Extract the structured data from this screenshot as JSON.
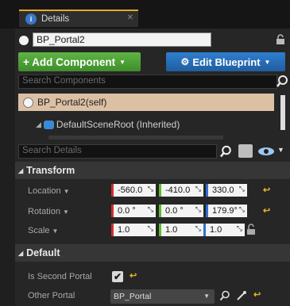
{
  "tab": {
    "title": "Details"
  },
  "actor": {
    "name": "BP_Portal2"
  },
  "toolbar": {
    "add_component": "+ Add Component",
    "edit_blueprint": "Edit Blueprint"
  },
  "components": {
    "search_placeholder": "Search Components",
    "root_item": "BP_Portal2(self)",
    "child_item": "DefaultSceneRoot (Inherited)"
  },
  "details": {
    "search_placeholder": "Search Details"
  },
  "transform": {
    "title": "Transform",
    "location": {
      "label": "Location",
      "x": "-560.0",
      "y": "-410.0",
      "z": "330.0"
    },
    "rotation": {
      "label": "Rotation",
      "x": "0.0 °",
      "y": "0.0 °",
      "z": "179.9°"
    },
    "scale": {
      "label": "Scale",
      "x": "1.0",
      "y": "1.0",
      "z": "1.0"
    }
  },
  "default_section": {
    "title": "Default",
    "is_second_portal": {
      "label": "Is Second Portal",
      "checked": true,
      "mark": "✔"
    },
    "other_portal": {
      "label": "Other Portal",
      "value": "BP_Portal"
    }
  },
  "colors": {
    "add_green": "#4ea437",
    "edit_blue": "#2a72bd",
    "selection": "#dcc0a4",
    "axis_x": "#d22d2d",
    "axis_y": "#5bbf2a",
    "axis_z": "#2f6fd4",
    "reset": "#e7b527"
  }
}
